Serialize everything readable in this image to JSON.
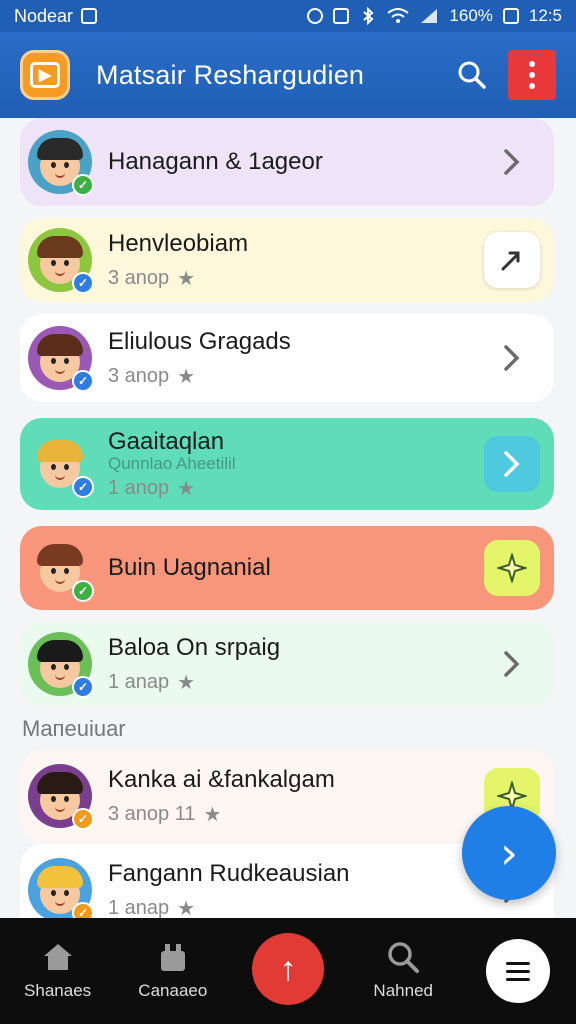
{
  "status_bar": {
    "carrier": "Nodear",
    "battery": "160%",
    "time": "12:5"
  },
  "app_bar": {
    "title": "Matsair Reshargudien"
  },
  "rows": [
    {
      "name": "Hanagann & 1ageor",
      "meta": "",
      "bg": "#efe3f7",
      "avatar_bg": "#4aa3c7",
      "hair": "#2a2a2a",
      "badge": "#3cb043",
      "action": "chevron-right"
    },
    {
      "name": "Henvleobiam",
      "meta": "3 anop",
      "bg": "#fdf7dc",
      "avatar_bg": "#8dc63f",
      "hair": "#6b3a1e",
      "badge": "#2f7de1",
      "action": "share"
    },
    {
      "name": "Eliulous Gragads",
      "meta": "3 anop",
      "bg": "#ffffff",
      "avatar_bg": "#9b59b6",
      "hair": "#5a2e1a",
      "badge": "#2f7de1",
      "action": "chevron-right"
    },
    {
      "name": "Gaaitaqlan",
      "subtitle": "Qunnlao Aheetilil",
      "meta": "1 anop",
      "bg": "#5fdcb8",
      "avatar_bg": "#5fdcb8",
      "hair": "#e9b43a",
      "badge": "#2f7de1",
      "action": "chevron-right"
    },
    {
      "name": "Buin Uagnanial",
      "meta": "",
      "bg": "#f7967a",
      "avatar_bg": "#f7967a",
      "hair": "#7a3a22",
      "badge": "#3cb043",
      "action": "sparkle"
    },
    {
      "name": "Baloa On srpaig",
      "meta": "1 anap",
      "bg": "#ebfaee",
      "avatar_bg": "#6bbf59",
      "hair": "#1a1a1a",
      "badge": "#2f7de1",
      "action": "chevron-right"
    }
  ],
  "section_header": "Maпeuiuar",
  "rows2": [
    {
      "name": "Kanka ai &fankalgam",
      "meta": "3 anop 11",
      "bg": "#fdf6f2",
      "avatar_bg": "#7a3e8e",
      "hair": "#2a1a14",
      "badge": "#f29a1e",
      "action": "sparkle"
    },
    {
      "name": "Fangann Rudkeausian",
      "meta": "1 anap",
      "bg": "#ffffff",
      "avatar_bg": "#4aa3e0",
      "hair": "#f2c23a",
      "badge": "#f29a1e",
      "action": "chevron-right"
    }
  ],
  "bottom_nav": {
    "items": [
      {
        "label": "Shanaes"
      },
      {
        "label": "Canaaeo"
      },
      {
        "label": ""
      },
      {
        "label": "Nahned"
      },
      {
        "label": ""
      }
    ]
  },
  "colors": {
    "primary": "#1f5fb6",
    "accent": "#e23a35",
    "fab": "#1f7fe6"
  }
}
